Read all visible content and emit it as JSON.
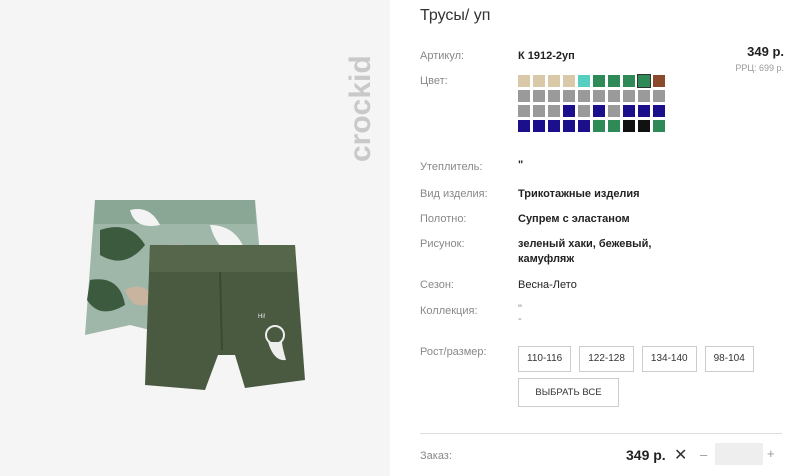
{
  "brand": {
    "logo_text": "crockid"
  },
  "product": {
    "title": "Трусы/ уп",
    "price": "349 р.",
    "rrp": "РРЦ: 699 р."
  },
  "fields": {
    "article": {
      "label": "Артикул:",
      "value": "К 1912-2уп"
    },
    "color": {
      "label": "Цвет:"
    },
    "insulation": {
      "label": "Утеплитель:",
      "value": "\""
    },
    "item_type": {
      "label": "Вид изделия:",
      "value": "Трикотажные изделия"
    },
    "fabric": {
      "label": "Полотно:",
      "value": "Супрем с эластаном"
    },
    "pattern": {
      "label": "Рисунок:",
      "value_line1": "зеленый хаки, бежевый,",
      "value_line2": "камуфляж"
    },
    "season": {
      "label": "Сезон:",
      "value": "Весна-Лето"
    },
    "collection": {
      "label": "Коллекция:",
      "value_line1": "\"",
      "value_line2": "-"
    },
    "size": {
      "label": "Рост/размер:"
    }
  },
  "swatches": [
    "#d9c9a8",
    "#d9c9a8",
    "#d9c9a8",
    "#d9c9a8",
    "#56cfc0",
    "#2e8b57",
    "#2e8b57",
    "#2e8b57",
    "#2e8b57",
    "#8b4a2b",
    "#9a9a9a",
    "#9a9a9a",
    "#9a9a9a",
    "#9a9a9a",
    "#9a9a9a",
    "#9a9a9a",
    "#9a9a9a",
    "#9a9a9a",
    "#9a9a9a",
    "#9a9a9a",
    "#9a9a9a",
    "#9a9a9a",
    "#9a9a9a",
    "#1b0f8c",
    "#9a9a9a",
    "#1b0f8c",
    "#9a9a9a",
    "#1b0f8c",
    "#1b0f8c",
    "#1b0f8c",
    "#1b0f8c",
    "#1b0f8c",
    "#1b0f8c",
    "#1b0f8c",
    "#1b0f8c",
    "#2e8b57",
    "#2e8b57",
    "#111111",
    "#111111",
    "#2e8b57"
  ],
  "selected_swatch_index": 8,
  "sizes": [
    "110-116",
    "122-128",
    "134-140",
    "98-104"
  ],
  "select_all_label": "ВЫБРАТЬ ВСЕ",
  "order": {
    "label": "Заказ:",
    "price": "349 р.",
    "remove_glyph": "✕",
    "minus_glyph": "–",
    "plus_glyph": "+"
  },
  "colors": {
    "logo": "#c9c9c9",
    "khaki": "#4a5a40",
    "camo_light": "#9fb7a9",
    "camo_beige": "#c9b4a0",
    "camo_dark": "#3c5a3e"
  }
}
